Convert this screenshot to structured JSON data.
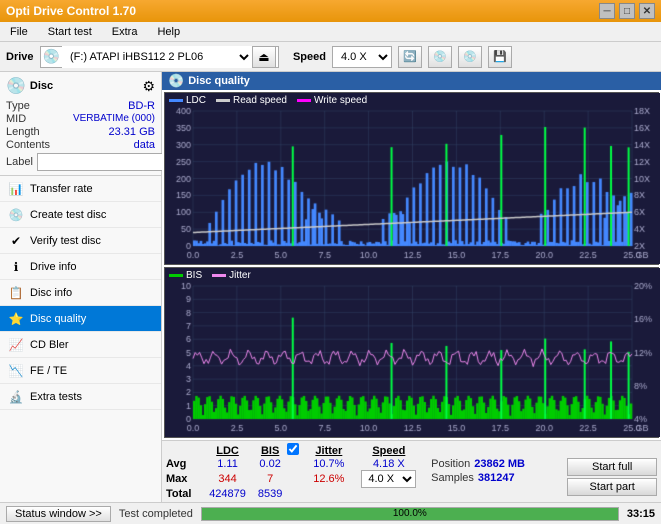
{
  "app": {
    "title": "Opti Drive Control 1.70",
    "title_icon": "💿"
  },
  "title_controls": {
    "minimize": "─",
    "maximize": "□",
    "close": "✕"
  },
  "menu": {
    "items": [
      "File",
      "Start test",
      "Extra",
      "Help"
    ]
  },
  "drive_bar": {
    "label": "Drive",
    "drive_value": "(F:) ATAPI iHBS112  2 PL06",
    "eject_icon": "⏏",
    "speed_label": "Speed",
    "speed_value": "4.0 X"
  },
  "disc_panel": {
    "title": "Disc",
    "type_label": "Type",
    "type_value": "BD-R",
    "mid_label": "MID",
    "mid_value": "VERBATIMe (000)",
    "length_label": "Length",
    "length_value": "23.31 GB",
    "contents_label": "Contents",
    "contents_value": "data",
    "label_label": "Label",
    "label_value": ""
  },
  "nav": {
    "items": [
      {
        "id": "transfer-rate",
        "label": "Transfer rate",
        "icon": "📊"
      },
      {
        "id": "create-test-disc",
        "label": "Create test disc",
        "icon": "💿"
      },
      {
        "id": "verify-test-disc",
        "label": "Verify test disc",
        "icon": "✔"
      },
      {
        "id": "drive-info",
        "label": "Drive info",
        "icon": "ℹ"
      },
      {
        "id": "disc-info",
        "label": "Disc info",
        "icon": "📋"
      },
      {
        "id": "disc-quality",
        "label": "Disc quality",
        "icon": "⭐",
        "active": true
      },
      {
        "id": "cd-bler",
        "label": "CD Bler",
        "icon": "📈"
      },
      {
        "id": "fe-te",
        "label": "FE / TE",
        "icon": "📉"
      },
      {
        "id": "extra-tests",
        "label": "Extra tests",
        "icon": "🔬"
      }
    ]
  },
  "status_bar": {
    "button_label": "Status window >>",
    "progress": 100,
    "progress_text": "100.0%",
    "time": "33:15",
    "status_text": "Test completed"
  },
  "chart": {
    "title": "Disc quality",
    "legend": [
      {
        "label": "LDC",
        "color": "#0000ff"
      },
      {
        "label": "Read speed",
        "color": "#cccccc"
      },
      {
        "label": "Write speed",
        "color": "#ff00ff"
      }
    ],
    "legend2": [
      {
        "label": "BIS",
        "color": "#00aa00"
      },
      {
        "label": "Jitter",
        "color": "#ff88ff"
      }
    ],
    "x_labels": [
      "0.0",
      "2.5",
      "5.0",
      "7.5",
      "10.0",
      "12.5",
      "15.0",
      "17.5",
      "20.0",
      "22.5",
      "25.0"
    ],
    "y_left_top": [
      "400",
      "350",
      "300",
      "250",
      "200",
      "150",
      "100",
      "50"
    ],
    "y_right_top": [
      "18X",
      "16X",
      "14X",
      "12X",
      "10X",
      "8X",
      "6X",
      "4X",
      "2X"
    ],
    "y_left_bot": [
      "10",
      "9",
      "8",
      "7",
      "6",
      "5",
      "4",
      "3",
      "2",
      "1"
    ],
    "y_right_bot": [
      "20%",
      "16%",
      "12%",
      "8%",
      "4%"
    ]
  },
  "stats": {
    "ldc_header": "LDC",
    "bis_header": "BIS",
    "jitter_header": "Jitter",
    "speed_header": "Speed",
    "avg_label": "Avg",
    "ldc_avg": "1.11",
    "bis_avg": "0.02",
    "jitter_avg": "10.7%",
    "speed_avg": "4.18 X",
    "max_label": "Max",
    "ldc_max": "344",
    "bis_max": "7",
    "jitter_max": "12.6%",
    "speed_combo": "4.0 X",
    "total_label": "Total",
    "ldc_total": "424879",
    "bis_total": "8539",
    "position_label": "Position",
    "position_val": "23862 MB",
    "samples_label": "Samples",
    "samples_val": "381247",
    "jitter_checked": true,
    "start_full_label": "Start full",
    "start_part_label": "Start part"
  }
}
